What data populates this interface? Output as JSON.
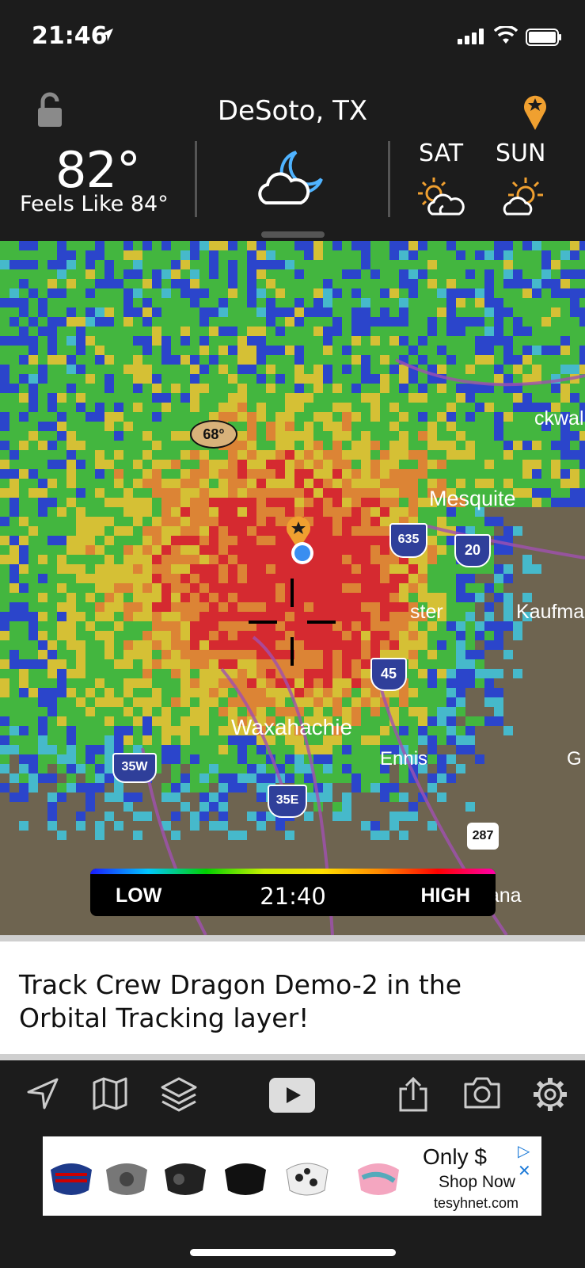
{
  "status_bar": {
    "time": "21:46"
  },
  "header": {
    "city": "DeSoto, TX",
    "temperature": "82°",
    "feels_like": "Feels Like 84°",
    "forecast": [
      {
        "day": "SAT",
        "icon": "sun-cloud-icon"
      },
      {
        "day": "SUN",
        "icon": "sun-cloud-icon"
      }
    ],
    "current_icon": "moon-cloud-icon"
  },
  "map": {
    "temperature_marker": "68°",
    "labels": {
      "mesquite": "Mesquite",
      "kaufman": "Kaufma",
      "rockwall": "ckwal",
      "waxahachie": "Waxahachie",
      "ennis": "Ennis",
      "corsicana": "Corsicana",
      "lancaster": "ster",
      "g": "G"
    },
    "highway_shields": [
      "635",
      "20",
      "45",
      "35W",
      "35E",
      "287"
    ],
    "legend": {
      "low": "LOW",
      "time": "21:40",
      "high": "HIGH"
    }
  },
  "promo": {
    "text": "Track Crew Dragon Demo-2 in the Orbital Tracking layer!"
  },
  "toolbar": {
    "items": [
      "navigate-icon",
      "map-icon",
      "layers-icon",
      "play-video-icon",
      "share-icon",
      "camera-icon",
      "settings-icon"
    ]
  },
  "ad": {
    "only": "Only $",
    "shop_now": "Shop Now",
    "domain": "tesyhnet.com"
  },
  "colors": {
    "accent_orange": "#f0a030",
    "moon_blue": "#4fb3ff",
    "background": "#1c1c1c"
  }
}
